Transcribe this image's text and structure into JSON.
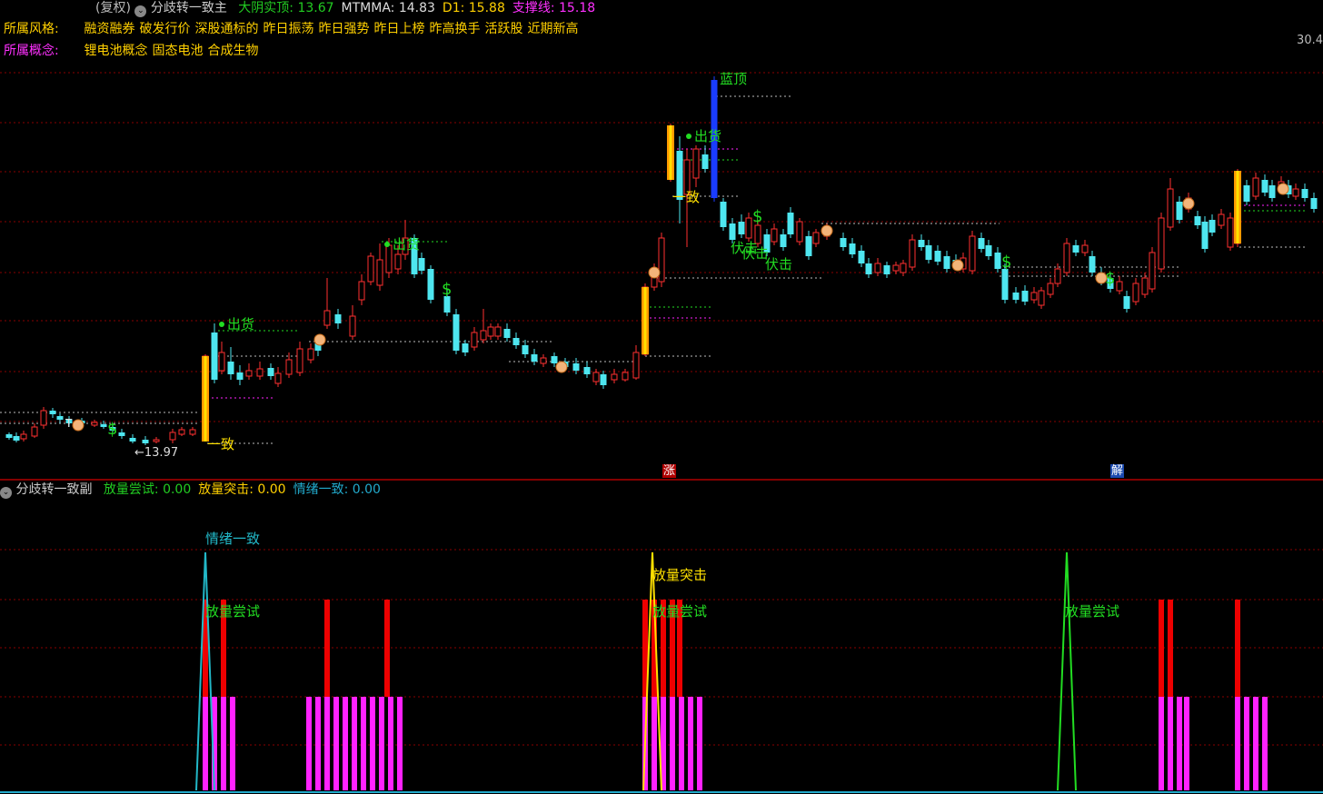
{
  "header": {
    "restore": "(复权)",
    "indicator_name": "分歧转一致主",
    "items": [
      {
        "label": "大阴实顶",
        "value": "13.67",
        "color": "#22cc22"
      },
      {
        "label": "MTMMA",
        "value": "14.83",
        "color": "#dddddd"
      },
      {
        "label": "D1",
        "value": "15.88",
        "color": "#ffd000"
      },
      {
        "label": "支撑线",
        "value": "15.18",
        "color": "#ff30ff"
      }
    ]
  },
  "style_row": {
    "label": "所属风格:",
    "tags": [
      "融资融券",
      "破发行价",
      "深股通标的",
      "昨日振荡",
      "昨日强势",
      "昨日上榜",
      "昨高换手",
      "活跃股",
      "近期新高"
    ]
  },
  "concept_row": {
    "label": "所属概念:",
    "tags": [
      "锂电池概念",
      "固态电池",
      "合成生物"
    ]
  },
  "price_axis_label": "30.4",
  "low_label": "←13.97",
  "chart_text": {
    "chuhuo": "出货",
    "lanting": "蓝顶",
    "yizhi": "一致",
    "fuji": "伏击",
    "dollar": "$"
  },
  "markers": {
    "zhang": "涨",
    "jie": "解"
  },
  "sub_header": {
    "name": "分歧转一致副",
    "items": [
      {
        "label": "放量尝试",
        "value": "0.00",
        "color": "#22cc22"
      },
      {
        "label": "放量突击",
        "value": "0.00",
        "color": "#ffd000"
      },
      {
        "label": "情绪一致",
        "value": "0.00",
        "color": "#22aacc"
      }
    ]
  },
  "sub_labels": {
    "qingxu": "情绪一致",
    "tuji": "放量突击",
    "changshi": "放量尝试"
  },
  "colors": {
    "up": "#ff3030",
    "down": "#4ee6f0",
    "grid": "#8a0000",
    "magenta": "#ff22ff",
    "green": "#22dd22",
    "yellow": "#ffe000",
    "cyan": "#22b8c8",
    "blue": "#1a3cff",
    "orange": "#ff9a00"
  }
}
